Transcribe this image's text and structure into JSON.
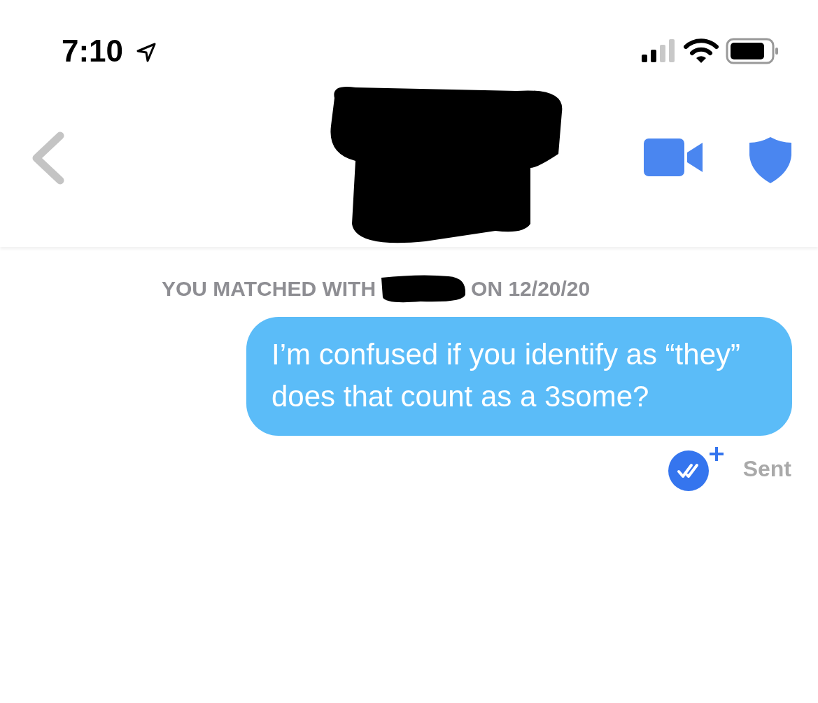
{
  "status_bar": {
    "time": "7:10"
  },
  "match_notice": {
    "prefix": "YOU MATCHED WITH",
    "suffix": "ON 12/20/20"
  },
  "messages": [
    {
      "text": "I’m confused if you identify as “they” does that count as a 3some?",
      "status": "Sent"
    }
  ]
}
